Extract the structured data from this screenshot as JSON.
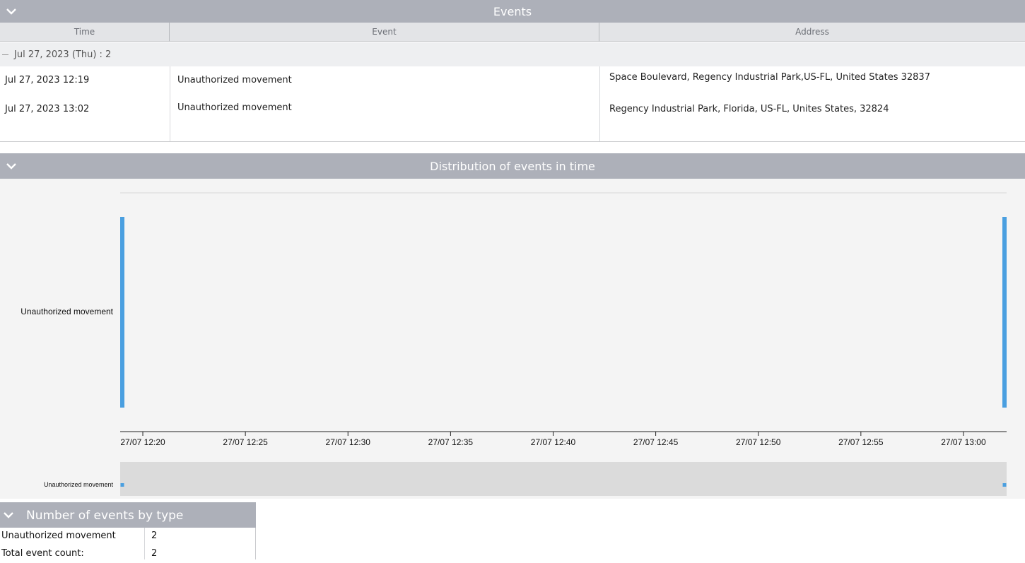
{
  "events_panel": {
    "title": "Events",
    "columns": [
      "Time",
      "Event",
      "Address"
    ],
    "group_label": "Jul 27, 2023 (Thu) : 2",
    "rows": [
      {
        "time": "Jul 27, 2023 12:19",
        "event": "Unauthorized movement",
        "address": "Space Boulevard, Regency Industrial Park,US-FL, United States 32837"
      },
      {
        "time": "Jul 27, 2023 13:02",
        "event": "Unauthorized movement",
        "address": "Regency Industrial Park, Florida, US-FL, Unites States, 32824"
      }
    ]
  },
  "distribution_panel": {
    "title": "Distribution of events in time"
  },
  "chart_data": {
    "type": "timeline",
    "categories": [
      "Unauthorized movement"
    ],
    "x_ticks": [
      "27/07 12:20",
      "27/07 12:25",
      "27/07 12:30",
      "27/07 12:35",
      "27/07 12:40",
      "27/07 12:45",
      "27/07 12:50",
      "27/07 12:55",
      "27/07 13:00"
    ],
    "xlim": [
      "27/07 12:19",
      "27/07 13:02"
    ],
    "series": [
      {
        "name": "Unauthorized movement",
        "x": [
          "27/07 12:19",
          "27/07 13:02"
        ]
      }
    ],
    "overview_label": "Unauthorized movement",
    "bar_color": "#4a9fe0"
  },
  "summary_panel": {
    "title": "Number of events by type",
    "rows": [
      {
        "label": "Unauthorized movement",
        "value": "2"
      },
      {
        "label": "Total event count:",
        "value": "2"
      }
    ]
  },
  "icons": {
    "collapse": "chevron-down-icon",
    "group_toggle": "minus-icon"
  }
}
